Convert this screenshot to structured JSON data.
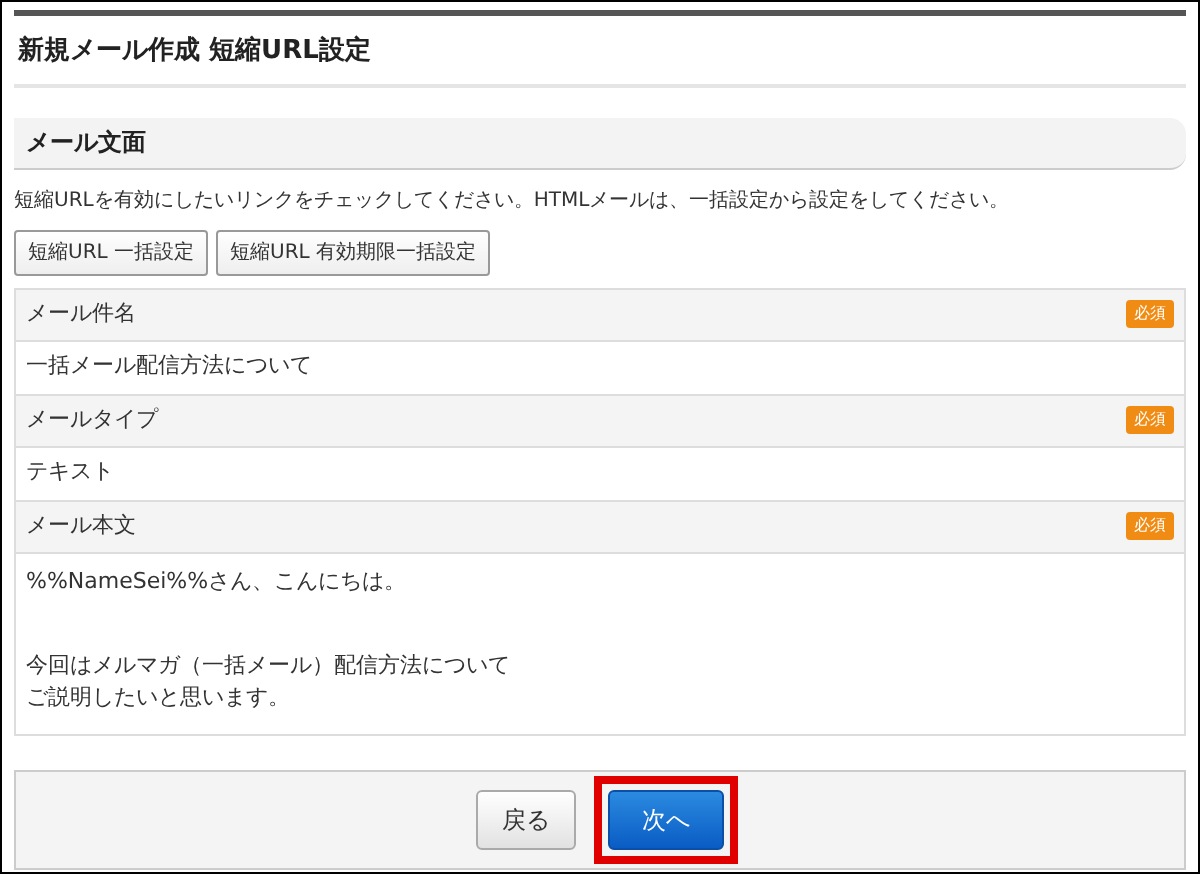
{
  "page": {
    "title": "新規メール作成 短縮URL設定"
  },
  "section": {
    "title": "メール文面",
    "description": "短縮URLを有効にしたいリンクをチェックしてください。HTMLメールは、一括設定から設定をしてください。"
  },
  "tool_buttons": [
    "短縮URL 一括設定",
    "短縮URL 有効期限一括設定"
  ],
  "fields": [
    {
      "label": "メール件名",
      "required_badge": "必須",
      "value_lines": [
        "一括メール配信方法について"
      ]
    },
    {
      "label": "メールタイプ",
      "required_badge": "必須",
      "value_lines": [
        "テキスト"
      ]
    },
    {
      "label": "メール本文",
      "required_badge": "必須",
      "paragraphs": [
        [
          "%%NameSei%%さん、こんにちは。"
        ],
        [
          "今回はメルマガ（一括メール）配信方法について",
          "ご説明したいと思います。"
        ]
      ]
    }
  ],
  "footer_buttons": [
    {
      "label": "戻る",
      "kind": "secondary",
      "highlighted": false
    },
    {
      "label": "次へ",
      "kind": "primary",
      "highlighted": true
    }
  ]
}
